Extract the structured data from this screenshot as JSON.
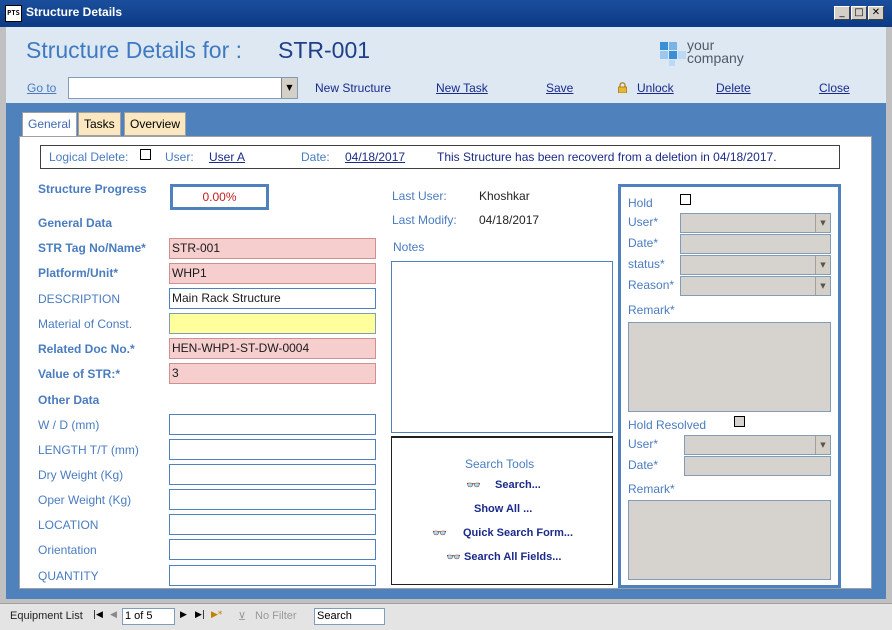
{
  "window": {
    "title": "Structure Details",
    "app_icon": "PTS"
  },
  "header": {
    "heading_label": "Structure Details for :",
    "structure_id": "STR-001",
    "logo_line1": "your",
    "logo_line2": "company"
  },
  "toolbar": {
    "goto_label": "Go to",
    "goto_value": "",
    "new_structure": "New Structure",
    "new_task": "New Task",
    "save": "Save",
    "unlock": "Unlock",
    "delete": "Delete",
    "close": "Close"
  },
  "tabs": [
    {
      "label": "General",
      "active": true
    },
    {
      "label": "Tasks",
      "active": false
    },
    {
      "label": "Overview",
      "active": false
    }
  ],
  "info": {
    "logical_delete_label": "Logical Delete:",
    "user_label": "User:",
    "user_value": "User A",
    "date_label": "Date:",
    "date_value": "04/18/2017",
    "message": "This Structure has been recoverd from a deletion in 04/18/2017."
  },
  "progress": {
    "label": "Structure Progress",
    "value": "0.00%"
  },
  "general": {
    "section_title": "General Data",
    "fields": [
      {
        "label": "STR Tag No/Name*",
        "value": "STR-001"
      },
      {
        "label": "Platform/Unit*",
        "value": "WHP1"
      },
      {
        "label": "DESCRIPTION",
        "value": "Main Rack Structure"
      },
      {
        "label": "Material of Const.",
        "value": ""
      },
      {
        "label": "Related Doc No.*",
        "value": "HEN-WHP1-ST-DW-0004"
      },
      {
        "label": "Value of STR:*",
        "value": "3"
      }
    ]
  },
  "other": {
    "section_title": "Other Data",
    "fields": [
      {
        "label": "W / D (mm)",
        "value": ""
      },
      {
        "label": "LENGTH T/T (mm)",
        "value": ""
      },
      {
        "label": "Dry Weight (Kg)",
        "value": ""
      },
      {
        "label": "Oper Weight (Kg)",
        "value": ""
      },
      {
        "label": "LOCATION",
        "value": ""
      },
      {
        "label": "Orientation",
        "value": ""
      },
      {
        "label": "QUANTITY",
        "value": ""
      }
    ]
  },
  "meta": {
    "last_user_label": "Last User:",
    "last_user_value": "Khoshkar",
    "last_modify_label": "Last Modify:",
    "last_modify_value": "04/18/2017",
    "notes_label": "Notes"
  },
  "search": {
    "title": "Search Tools",
    "search": "Search...",
    "show_all": "Show All ...",
    "quick": "Quick Search Form...",
    "all_fields": "Search All Fields..."
  },
  "hold": {
    "hold_label": "Hold",
    "user_label": "User*",
    "date_label": "Date*",
    "status_label": "status*",
    "reason_label": "Reason*",
    "remark_label": "Remark*",
    "resolved_label": "Hold Resolved",
    "r_user_label": "User*",
    "r_date_label": "Date*",
    "r_remark_label": "Remark*"
  },
  "navbar": {
    "label": "Equipment List",
    "record": "1 of 5",
    "filter": "No Filter",
    "search": "Search"
  },
  "colors": {
    "accent": "#4f81bd",
    "required": "#f6cece",
    "highlight": "#ffff9c"
  }
}
